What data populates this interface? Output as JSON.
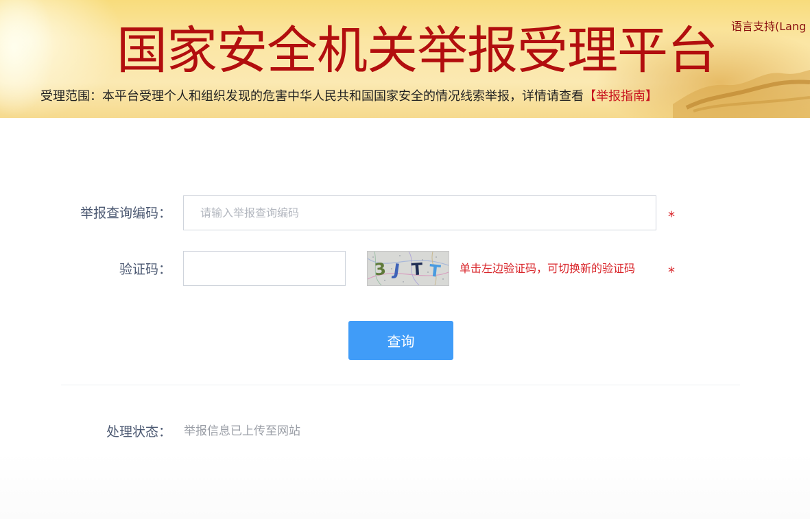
{
  "header": {
    "title": "国家安全机关举报受理平台",
    "scope_text": "受理范围：本平台受理个人和组织发现的危害中华人民共和国国家安全的情况线索举报，详情请查看",
    "guide_link": "【举报指南】",
    "language_link": "语言支持(Lang"
  },
  "form": {
    "code_label": "举报查询编码：",
    "code_placeholder": "请输入举报查询编码",
    "code_value": "",
    "captcha_label": "验证码：",
    "captcha_value": "",
    "captcha_text": "3JTT",
    "captcha_hint": "单击左边验证码，可切换新的验证码",
    "required_mark": "*",
    "query_button": "查询"
  },
  "result": {
    "status_label": "处理状态：",
    "status_value": "举报信息已上传至网站"
  },
  "colors": {
    "title_red": "#b20e0e",
    "required_red": "#d9262b",
    "button_blue": "#409cf8",
    "label_gray_blue": "#4d5a73"
  }
}
